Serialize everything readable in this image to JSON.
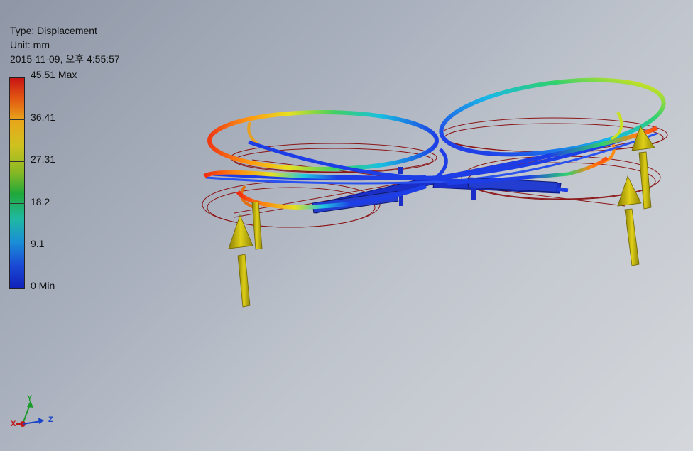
{
  "result_info": {
    "type_line": "Type: Displacement",
    "unit_line": "Unit: mm",
    "timestamp": "2015-11-09, 오후 4:55:57"
  },
  "legend": {
    "max_label": "45.51 Max",
    "ticks": [
      "36.41",
      "27.31",
      "18.2",
      "9.1"
    ],
    "min_label": "0 Min",
    "colors": [
      "#c81414",
      "#e9a51a",
      "#cfc21f",
      "#20a83a",
      "#1fb9a2",
      "#1a4ad6",
      "#1020b8"
    ]
  },
  "triad": {
    "x_label": "X",
    "y_label": "Y",
    "z_label": "Z"
  },
  "model": {
    "undeformed_outline_color": "#8a1515",
    "load_arrow_color": "#d4c311",
    "arm_color": "#1e3ee0"
  }
}
